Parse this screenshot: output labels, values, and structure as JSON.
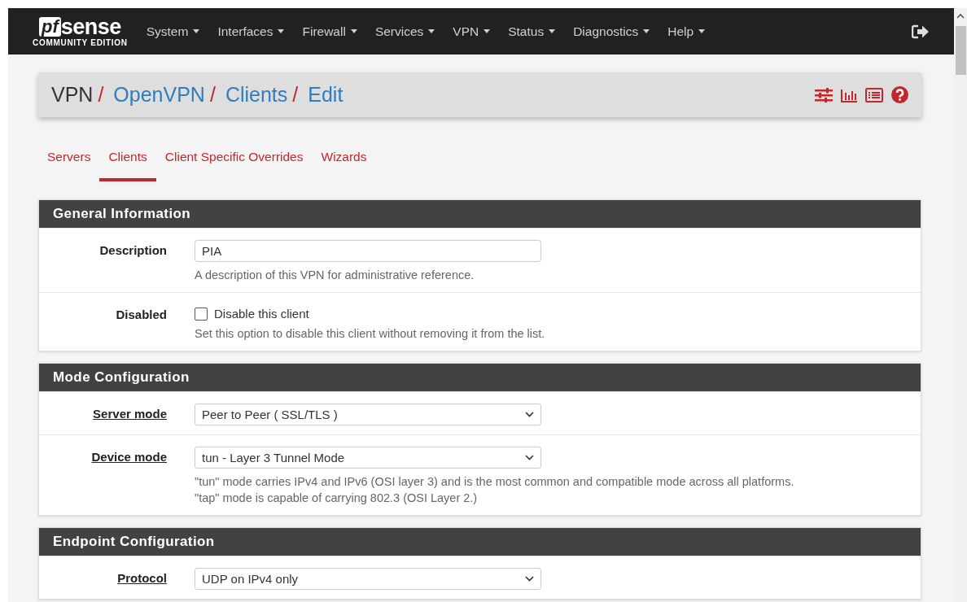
{
  "navbar": {
    "logo": {
      "mark": "pf",
      "word": "sense",
      "edition": "COMMUNITY EDITION"
    },
    "menus": [
      "System",
      "Interfaces",
      "Firewall",
      "Services",
      "VPN",
      "Status",
      "Diagnostics",
      "Help"
    ]
  },
  "breadcrumb": [
    {
      "label": "VPN",
      "kind": "plain",
      "separator": "/"
    },
    {
      "label": "OpenVPN",
      "kind": "link",
      "separator": "/"
    },
    {
      "label": "Clients",
      "kind": "link",
      "separator": "/"
    },
    {
      "label": "Edit",
      "kind": "link"
    }
  ],
  "tabs": [
    {
      "label": "Servers",
      "selected": false
    },
    {
      "label": "Clients",
      "selected": true
    },
    {
      "label": "Client Specific Overrides",
      "selected": false
    },
    {
      "label": "Wizards",
      "selected": false
    }
  ],
  "sections": [
    {
      "title": "General Information",
      "rows": [
        {
          "label": "Description",
          "label_link": false,
          "kind": "text",
          "value": "PIA",
          "help": [
            "A description of this VPN for administrative reference."
          ]
        },
        {
          "label": "Disabled",
          "label_link": false,
          "kind": "checkbox",
          "checked": false,
          "value": "Disable this client",
          "help": [
            "Set this option to disable this client without removing it from the list."
          ]
        }
      ]
    },
    {
      "title": "Mode Configuration",
      "rows": [
        {
          "label": "Server mode",
          "label_link": true,
          "kind": "select",
          "value": "Peer to Peer ( SSL/TLS )"
        },
        {
          "label": "Device mode",
          "label_link": true,
          "kind": "select",
          "value": "tun - Layer 3 Tunnel Mode",
          "help": [
            "\"tun\" mode carries IPv4 and IPv6 (OSI layer 3) and is the most common and compatible mode across all platforms.",
            "\"tap\" mode is capable of carrying 802.3 (OSI Layer 2.)"
          ]
        }
      ]
    },
    {
      "title": "Endpoint Configuration",
      "rows": [
        {
          "label": "Protocol",
          "label_link": true,
          "kind": "select",
          "value": "UDP on IPv4 only"
        }
      ]
    }
  ]
}
